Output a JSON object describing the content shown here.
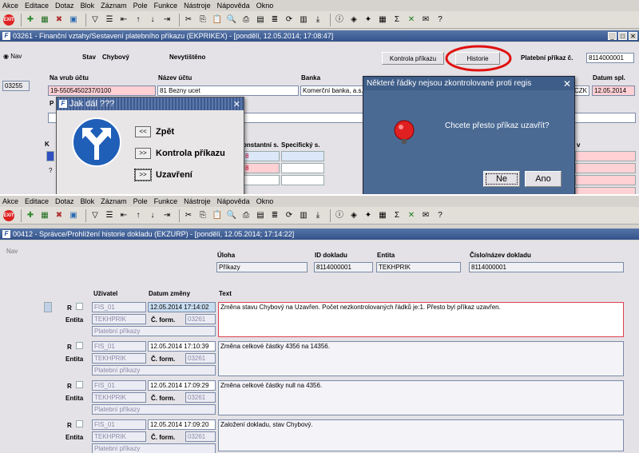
{
  "menu": [
    "Akce",
    "Editace",
    "Dotaz",
    "Blok",
    "Záznam",
    "Pole",
    "Funkce",
    "Nástroje",
    "Nápověda",
    "Okno"
  ],
  "toolbar": {
    "exit_label": "EXIT"
  },
  "top_form": {
    "title": "03261 - Finanční vztahy/Sestavení platebního příkazu (EKPRIKEX) - [pondělí, 12.05.2014; 17:08:47]",
    "nav_label": "Nav",
    "record_id": "03255",
    "stav_label": "Stav",
    "stav_value": "Chybový",
    "tisk_value": "Nevytištěno",
    "btn_kontrola": "Kontrola příkazu",
    "btn_historie": "Historie",
    "platebni_label": "Platební příkaz č.",
    "platebni_value": "8114000001",
    "na_vrub_label": "Na vrub účtu",
    "na_vrub_value": "19-5505450237/0100",
    "nazev_uctu_label": "Název účtu",
    "nazev_uctu_value": "81 Bezny ucet",
    "banka_label": "Banka",
    "banka_value": "Komerční banka, a.s.",
    "czk_value": "CZK",
    "datum_label": "Datum spl.",
    "datum_value": "12.05.2014",
    "p_label": "P",
    "k_label": "K",
    "q_label": "?",
    "konst_label": "onstantní s.",
    "spec_label": "Specifický s.",
    "v_label": "v",
    "konst_vals": [
      "8",
      "8"
    ]
  },
  "jak_dal": {
    "title": "Jak dál ???",
    "items": [
      {
        "btn": "<<",
        "label": "Zpět"
      },
      {
        "btn": ">>",
        "label": "Kontrola příkazu"
      },
      {
        "btn": ">>",
        "label": "Uzavření"
      }
    ]
  },
  "alert": {
    "title": "Některé řádky nejsou zkontrolované proti regis",
    "message": "Chcete přesto příkaz uzavřít?",
    "btn_no": "Ne",
    "btn_yes": "Ano"
  },
  "bottom_form": {
    "title": "00412 - Správce/Prohlížení historie dokladu (EKZURP) - [pondělí, 12.05.2014; 17:14:22]",
    "nav_label": "Nav",
    "uloha_label": "Úloha",
    "uloha_value": "Příkazy",
    "id_label": "ID dokladu",
    "id_value": "8114000001",
    "entita_label": "Entita",
    "entita_value": "TEKHPRIK",
    "cislo_label": "Číslo/název dokladu",
    "cislo_value": "8114000001",
    "uzivatel_label": "Uživatel",
    "datum_label": "Datum změny",
    "text_label": "Text",
    "r_label": "R",
    "entita_row_label": "Entita",
    "cform_label": "Č. form.",
    "records": [
      {
        "user": "FIS_01",
        "date": "12.05.2014 17:14:02",
        "entity": "TEKHPRIK",
        "form": "03261",
        "name": "Platební příkazy",
        "text": "Změna stavu Chybový na Uzavřen. Počet nezkontrolovaných řádků je:1. Přesto byl příkaz uzavřen."
      },
      {
        "user": "FIS_01",
        "date": "12.05.2014 17:10:39",
        "entity": "TEKHPRIK",
        "form": "03261",
        "name": "Platební příkazy",
        "text": "Změna celkové částky 4356 na 14356."
      },
      {
        "user": "FIS_01",
        "date": "12.05.2014 17:09:29",
        "entity": "TEKHPRIK",
        "form": "03261",
        "name": "Platební příkazy",
        "text": "Změna celkové částky null na 4356."
      },
      {
        "user": "FIS_01",
        "date": "12.05.2014 17:09:20",
        "entity": "TEKHPRIK",
        "form": "03261",
        "name": "Platební příkazy",
        "text": "Založení dokladu, stav Chybový."
      }
    ]
  }
}
